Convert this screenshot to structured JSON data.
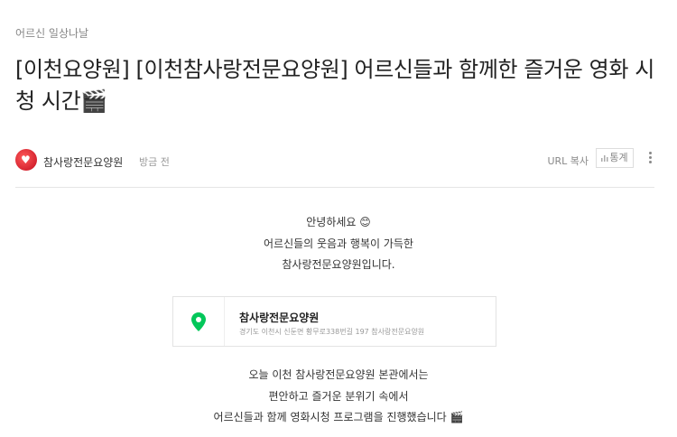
{
  "category": "어르신 일상나날",
  "post": {
    "title": "[이천요양원] [이천참사랑전문요양원] 어르신들과 함께한 즐거운 영화 시청 시간🎬",
    "author": "참사랑전문요양원",
    "time": "방금 전"
  },
  "toolbar": {
    "url_copy": "URL 복사",
    "stats": "통계"
  },
  "intro": {
    "line1": "안녕하세요 😊",
    "line2": "어르신들의 웃음과 행복이 가득한",
    "line3": "참사랑전문요양원입니다."
  },
  "map_card": {
    "name": "참사랑전문요양원",
    "address": "경기도 이천시 신둔면 황무로338번길 197 참사랑전문요양원",
    "pin_color": "#03c75a"
  },
  "body": {
    "line1": "오늘 이천 참사랑전문요양원 본관에서는",
    "line2": "편안하고 즐거운 분위기 속에서",
    "line3": "어르신들과 함께 영화시청 프로그램을 진행했습니다 🎬"
  },
  "colors": {
    "avatar": "#d0101f",
    "divider": "#e5e5e5"
  }
}
